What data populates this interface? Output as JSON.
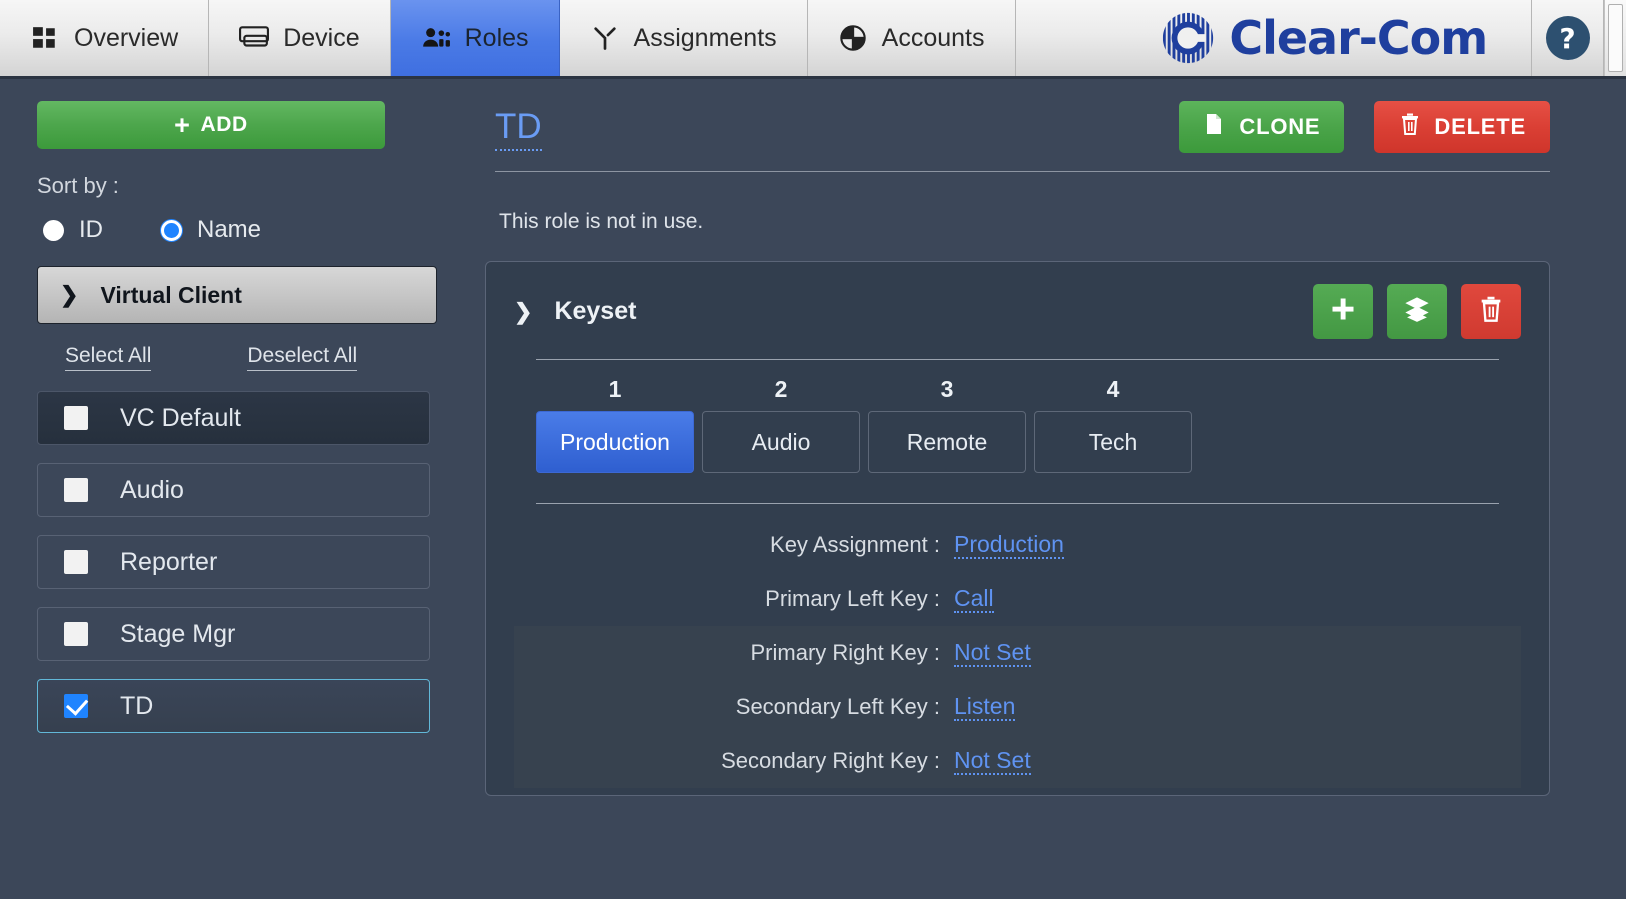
{
  "topnav": {
    "tabs": [
      {
        "label": "Overview",
        "icon": "grid-icon",
        "active": false
      },
      {
        "label": "Device",
        "icon": "device-icon",
        "active": false
      },
      {
        "label": "Roles",
        "icon": "people-icon",
        "active": true
      },
      {
        "label": "Assignments",
        "icon": "assignments-icon",
        "active": false
      },
      {
        "label": "Accounts",
        "icon": "accounts-icon",
        "active": false
      }
    ],
    "brand": "Clear-Com",
    "help_label": "?"
  },
  "sidebar": {
    "add_label": "ADD",
    "add_plus": "+",
    "sort_by_label": "Sort by :",
    "sort_options": [
      {
        "label": "ID",
        "selected": false
      },
      {
        "label": "Name",
        "selected": true
      }
    ],
    "group": {
      "title": "Virtual Client",
      "chevron": "❯"
    },
    "select_all_label": "Select All",
    "deselect_all_label": "Deselect All",
    "roles": [
      {
        "name": "VC Default",
        "checked": false,
        "selected": false,
        "shaded": true
      },
      {
        "name": "Audio",
        "checked": false,
        "selected": false,
        "shaded": false
      },
      {
        "name": "Reporter",
        "checked": false,
        "selected": false,
        "shaded": false
      },
      {
        "name": "Stage Mgr",
        "checked": false,
        "selected": false,
        "shaded": false
      },
      {
        "name": "TD",
        "checked": true,
        "selected": true,
        "shaded": false
      }
    ]
  },
  "main": {
    "role_title": "TD",
    "clone_label": "CLONE",
    "delete_label": "DELETE",
    "status_text": "This role is not in use.",
    "keyset": {
      "title": "Keyset",
      "chevron": "❯",
      "add_glyph": "＋",
      "clone_glyph": "≣",
      "delete_glyph": "🗑",
      "keys": [
        {
          "number": "1",
          "label": "Production",
          "active": true
        },
        {
          "number": "2",
          "label": "Audio",
          "active": false
        },
        {
          "number": "3",
          "label": "Remote",
          "active": false
        },
        {
          "number": "4",
          "label": "Tech",
          "active": false
        }
      ],
      "details": [
        {
          "label": "Key Assignment :",
          "value": "Production"
        },
        {
          "label": "Primary Left Key :",
          "value": "Call"
        },
        {
          "label": "Primary Right Key :",
          "value": "Not Set"
        },
        {
          "label": "Secondary Left Key :",
          "value": "Listen"
        },
        {
          "label": "Secondary Right Key :",
          "value": "Not Set"
        }
      ]
    }
  },
  "colors": {
    "background": "#3c4759",
    "panel": "#323e4e",
    "accent_blue": "#4a7ce8",
    "link_blue": "#5f93f2",
    "green": "#4aa449",
    "red": "#d03a30",
    "brand_blue": "#1f3f9e"
  }
}
